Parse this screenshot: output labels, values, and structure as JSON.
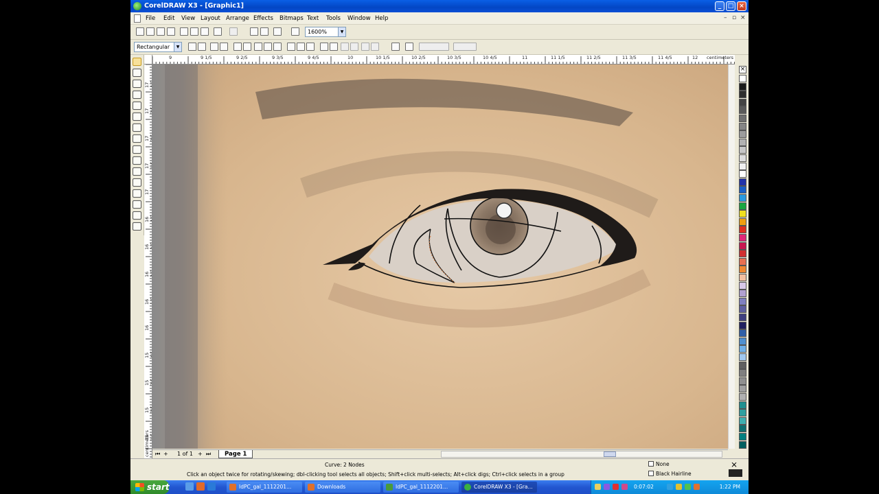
{
  "window": {
    "title": "CorelDRAW X3 - [Graphic1]"
  },
  "menu": [
    "File",
    "Edit",
    "View",
    "Layout",
    "Arrange",
    "Effects",
    "Bitmaps",
    "Text",
    "Tools",
    "Window",
    "Help"
  ],
  "toolbar": {
    "zoom": "1600%"
  },
  "propertybar": {
    "selection_mode": "Rectangular"
  },
  "ruler": {
    "top_labels": [
      "9",
      "9 1/5",
      "9 2/5",
      "9 3/5",
      "9 4/5",
      "10",
      "10 1/5",
      "10 2/5",
      "10 3/5",
      "10 4/5",
      "11",
      "11 1/5",
      "11 2/5",
      "11 3/5",
      "11 4/5",
      "12"
    ],
    "units": "centimeters",
    "left_labels": [
      "17 4/5",
      "17 3/5",
      "17 2/5",
      "17 1/5",
      "17",
      "16 4/5",
      "16 3/5",
      "16 2/5",
      "16 1/5",
      "16",
      "15 4/5",
      "15 3/5",
      "15 2/5",
      "15 1/5"
    ],
    "left_units": "centimeters"
  },
  "pages": {
    "counter": "1 of 1",
    "tab": "Page 1"
  },
  "status": {
    "object_info": "Curve: 2 Nodes",
    "hint": "Click an object twice for rotating/skewing; dbl-clicking tool selects all objects; Shift+click multi-selects; Alt+click digs; Ctrl+click selects in a group",
    "fill": "None",
    "outline": "Black Hairline"
  },
  "palette_colors": [
    "#ffffff",
    "#1a1a1a",
    "#2e2e2e",
    "#444444",
    "#5a5a5a",
    "#707070",
    "#868686",
    "#9c9c9c",
    "#b2b2b2",
    "#c8c8c8",
    "#dedede",
    "#f0f0f0",
    "#ffffff",
    "#2233aa",
    "#1a60c8",
    "#2a9ae0",
    "#1aa640",
    "#f0e020",
    "#f0a010",
    "#e03020",
    "#e02878",
    "#c81850",
    "#d03030",
    "#e87050",
    "#f08830",
    "#f4c0a0",
    "#d8c8e8",
    "#b0a0d0",
    "#8080c0",
    "#6060a0",
    "#404080",
    "#202060",
    "#3060a8",
    "#5090d0",
    "#70b0e8",
    "#a0c8f0",
    "#606060",
    "#808080",
    "#909090",
    "#a0a0a0",
    "#b0b0b0",
    "#209090",
    "#30a0a0",
    "#40b0b0",
    "#107070",
    "#008080",
    "#006060"
  ],
  "taskbar": {
    "start": "start",
    "tasks": [
      "IdPC_gal_1112201...",
      "Downloads",
      "IdPC_gal_1112201...",
      "CorelDRAW X3 - [Gra..."
    ],
    "timer": "0:07:02",
    "clock": "1:22 PM"
  }
}
